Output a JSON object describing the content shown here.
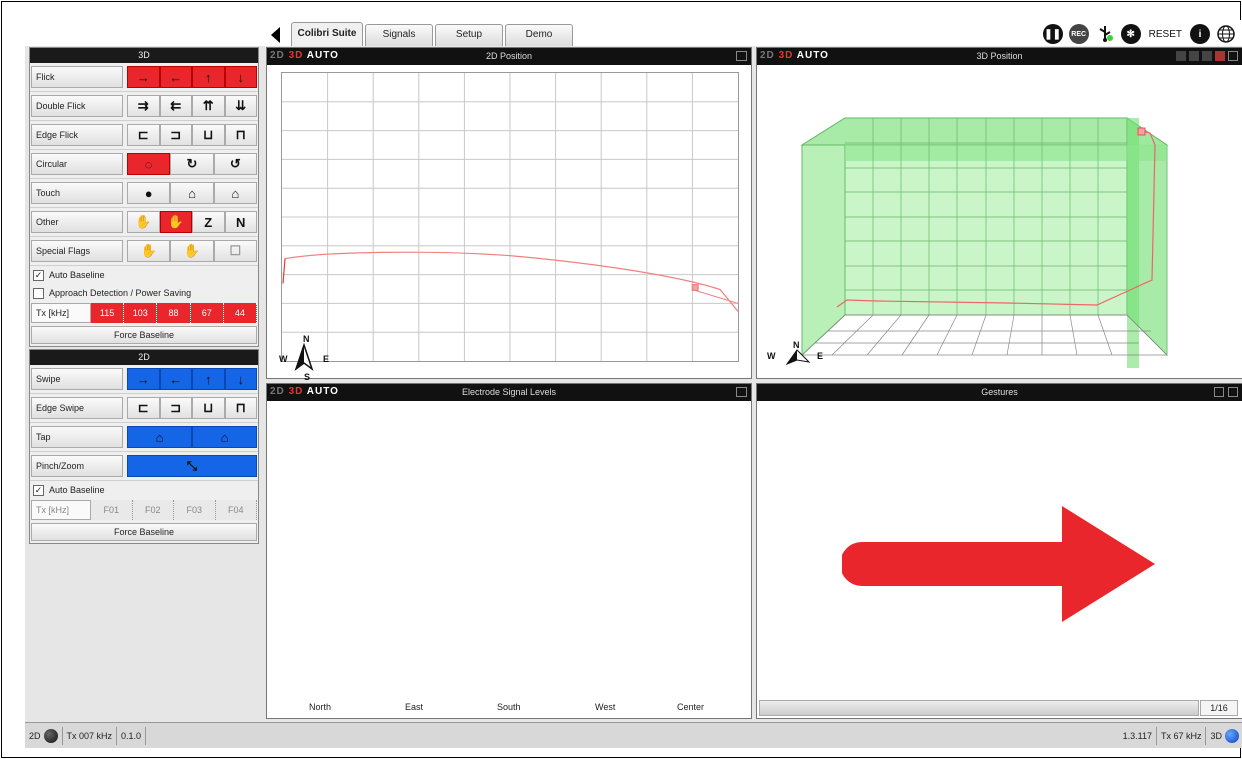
{
  "tabs": [
    {
      "label": "Colibri Suite",
      "active": true
    },
    {
      "label": "Signals"
    },
    {
      "label": "Setup"
    },
    {
      "label": "Demo"
    }
  ],
  "toolbar": {
    "rec_label": "REC",
    "reset_label": "RESET",
    "info_label": "i"
  },
  "left_3d": {
    "header": "3D",
    "rows": [
      {
        "label": "Flick",
        "icons": [
          "→",
          "←",
          "↑",
          "↓"
        ],
        "style": "red-all"
      },
      {
        "label": "Double Flick",
        "icons": [
          "⇉",
          "⇇",
          "⇈",
          "⇊"
        ]
      },
      {
        "label": "Edge Flick",
        "icons": [
          "⊏",
          "⊐",
          "⊔",
          "⊓"
        ]
      },
      {
        "label": "Circular",
        "icons": [
          "◌",
          "↻",
          "↺"
        ],
        "active": 0
      },
      {
        "label": "Touch",
        "icons": [
          "●",
          "⌂",
          "⌂"
        ]
      },
      {
        "label": "Other",
        "icons": [
          "✋",
          "✋",
          "Z",
          "N"
        ],
        "active": 1
      },
      {
        "label": "Special Flags",
        "icons": [
          "✋",
          "✋",
          "☐"
        ]
      }
    ],
    "auto_baseline": "Auto Baseline",
    "approach": "Approach Detection / Power Saving",
    "tx_label": "Tx [kHz]",
    "tx_values": [
      "115",
      "103",
      "88",
      "67",
      "44"
    ],
    "force_baseline": "Force Baseline"
  },
  "left_2d": {
    "header": "2D",
    "rows": [
      {
        "label": "Swipe",
        "icons": [
          "→",
          "←",
          "↑",
          "↓"
        ],
        "style": "blue-all"
      },
      {
        "label": "Edge Swipe",
        "icons": [
          "⊏",
          "⊐",
          "⊔",
          "⊓"
        ]
      },
      {
        "label": "Tap",
        "icons": [
          "⌂",
          "⌂"
        ],
        "style": "blue-all"
      },
      {
        "label": "Pinch/Zoom",
        "icons": [
          "⤡"
        ],
        "style": "blue-all"
      }
    ],
    "auto_baseline": "Auto Baseline",
    "tx_label": "Tx [kHz]",
    "tx_values": [
      "F01",
      "F02",
      "F03",
      "F04"
    ],
    "force_baseline": "Force Baseline"
  },
  "panels": {
    "pos2d": {
      "title": "2D Position",
      "mode": [
        "2D",
        "3D",
        "AUTO"
      ]
    },
    "pos3d": {
      "title": "3D Position",
      "mode": [
        "2D",
        "3D",
        "AUTO"
      ]
    },
    "signals": {
      "title": "Electrode Signal Levels",
      "mode": [
        "2D",
        "3D",
        "AUTO"
      ],
      "channels": [
        "North",
        "East",
        "South",
        "West",
        "Center"
      ]
    },
    "gestures": {
      "title": "Gestures",
      "page": "1/16"
    }
  },
  "compass": {
    "n": "N",
    "s": "S",
    "e": "E",
    "w": "W"
  },
  "statusbar": {
    "left_mode": "2D",
    "tx_left": "Tx 007 kHz",
    "version_left": "0.1.0",
    "version_right": "1.3.117",
    "tx_right": "Tx 67 kHz",
    "right_mode": "3D"
  },
  "colors": {
    "red": "#e8262c",
    "blue": "#1466e6",
    "green": "#3ad23a"
  }
}
